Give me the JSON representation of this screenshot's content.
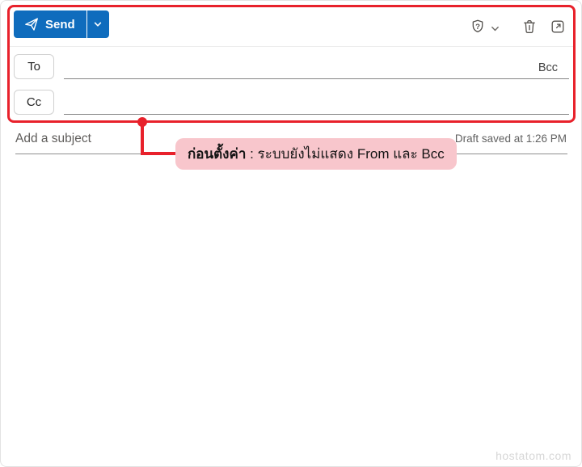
{
  "colors": {
    "accent_red": "#e8212b",
    "callout_pink": "#f8c6cc",
    "send_blue": "#0f6cbd"
  },
  "toolbar": {
    "send_label": "Send",
    "icon_names": [
      "send-icon",
      "chevron-down-icon",
      "help-shield-icon",
      "help-chevron-icon",
      "delete-icon",
      "open-in-new-window-icon"
    ]
  },
  "recipients": {
    "to_label": "To",
    "cc_label": "Cc",
    "bcc_label": "Bcc",
    "to_value": "",
    "cc_value": ""
  },
  "subject": {
    "placeholder": "Add a subject",
    "value": "",
    "draft_status": "Draft saved at 1:26 PM"
  },
  "annotation": {
    "bold_text": "ก่อนตั้งค่า",
    "text": " : ระบบยังไม่แสดง From และ Bcc"
  },
  "watermark": "hostatom.com"
}
